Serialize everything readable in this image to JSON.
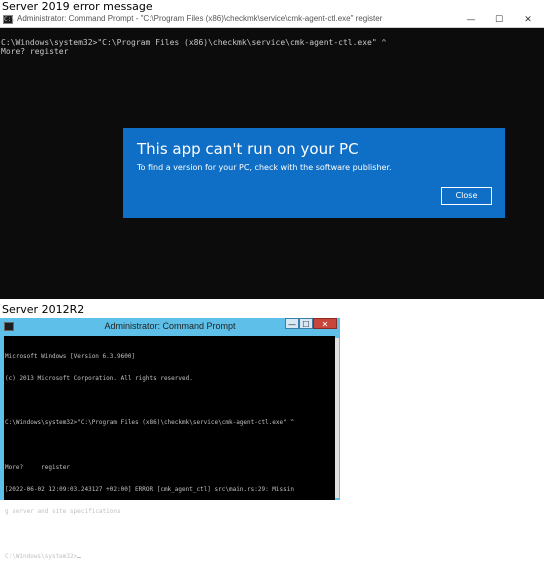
{
  "captions": {
    "top": "Server 2019 error message",
    "bottom": "Server 2012R2"
  },
  "win2019": {
    "title": "Administrator: Command Prompt - \"C:\\Program Files (x86)\\checkmk\\service\\cmk-agent-ctl.exe\"  register",
    "controls": [
      "—",
      "☐",
      "✕"
    ],
    "lines": [
      "C:\\Windows\\system32>\"C:\\Program Files (x86)\\checkmk\\service\\cmk-agent-ctl.exe\" ^",
      "More? register"
    ],
    "dialog": {
      "title": "This app can't run on your PC",
      "message": "To find a version for your PC, check with the software publisher.",
      "button": "Close",
      "bg_color": "#0f6fc6"
    }
  },
  "win2012": {
    "title": "Administrator: Command Prompt",
    "controls": [
      "—",
      "☐",
      "✕"
    ],
    "lines": [
      "Microsoft Windows [Version 6.3.9600]",
      "(c) 2013 Microsoft Corporation. All rights reserved.",
      "",
      "C:\\Windows\\system32>\"C:\\Program Files (x86)\\checkmk\\service\\cmk-agent-ctl.exe\" ^",
      "",
      "More?     register",
      "[2022-06-02 12:09:03.243127 +02:00] ERROR [cmk_agent_ctl] src\\main.rs:29: Missin",
      "g server and site specifications",
      "",
      "C:\\Windows\\system32>"
    ],
    "title_color": "#5ec0e8",
    "close_color": "#c7453b"
  }
}
